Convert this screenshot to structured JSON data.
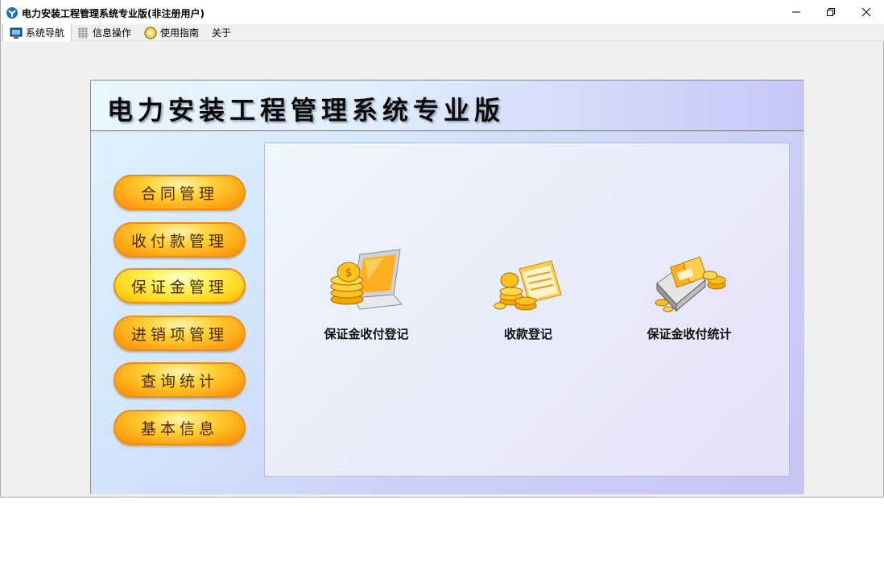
{
  "window": {
    "title": "电力安装工程管理系统专业版(非注册用户)",
    "controls": {
      "minimize": "minimize",
      "restore": "restore",
      "close": "close"
    }
  },
  "tabs": [
    {
      "label": "系统导航",
      "icon": "monitor-icon",
      "active": true
    },
    {
      "label": "信息操作",
      "icon": "grid-icon",
      "active": false
    },
    {
      "label": "使用指南",
      "icon": "lightbulb-icon",
      "active": false
    },
    {
      "label": "关于",
      "icon": "",
      "active": false
    }
  ],
  "header": {
    "title": "电力安装工程管理系统专业版"
  },
  "menu": [
    {
      "label": "合同管理"
    },
    {
      "label": "收付款管理"
    },
    {
      "label": "保证金管理",
      "highlighted": true
    },
    {
      "label": "进销项管理"
    },
    {
      "label": "查询统计"
    },
    {
      "label": "基本信息"
    }
  ],
  "functions": [
    {
      "label": "保证金收付登记",
      "icon": "laptop-coins-icon"
    },
    {
      "label": "收款登记",
      "icon": "coins-folder-icon"
    },
    {
      "label": "保证金收付统计",
      "icon": "money-stack-icon"
    }
  ],
  "colors": {
    "button_orange": "#ffa412",
    "button_border": "#f28a1a",
    "panel_lavender": "#c9c4f7",
    "panel_cyan": "#dff2fc"
  }
}
